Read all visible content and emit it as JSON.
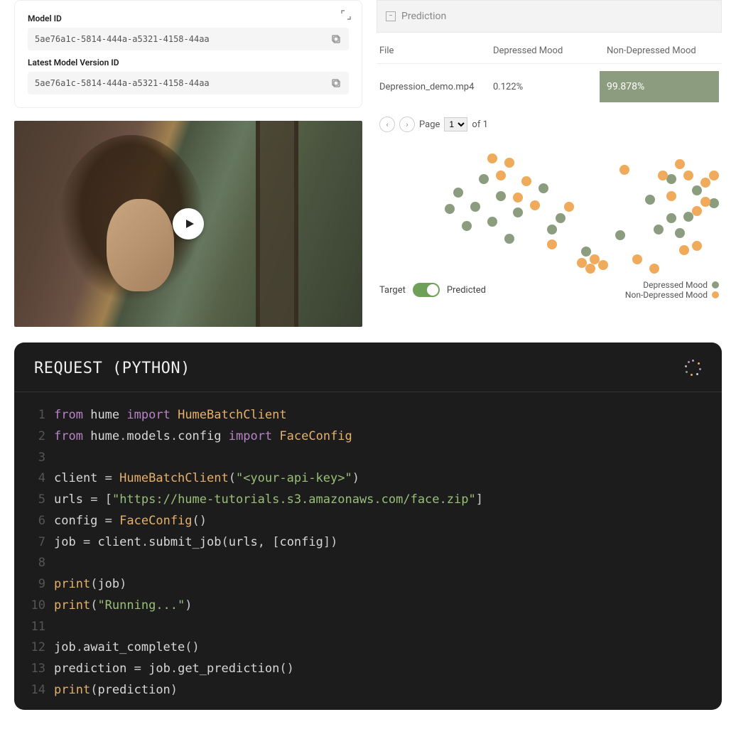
{
  "id_card": {
    "model_id_label": "Model ID",
    "model_id_value": "5ae76a1c-5814-444a-a5321-4158-44aa",
    "version_id_label": "Latest Model Version ID",
    "version_id_value": "5ae76a1c-5814-444a-a5321-4158-44aa"
  },
  "prediction": {
    "header": "Prediction",
    "columns": {
      "file": "File",
      "depressed": "Depressed Mood",
      "non_depressed": "Non-Depressed Mood"
    },
    "row": {
      "file": "Depression_demo.mp4",
      "depressed": "0.122%",
      "non_depressed": "99.878%"
    },
    "pager": {
      "page_label": "Page",
      "current": "1",
      "of_label": "of 1"
    }
  },
  "scatter_footer": {
    "target": "Target",
    "predicted": "Predicted",
    "legend_depressed": "Depressed Mood",
    "legend_non_depressed": "Non-Depressed Mood"
  },
  "code": {
    "title": "REQUEST (PYTHON)",
    "lines": [
      [
        [
          "kw",
          "from"
        ],
        [
          "sp",
          " "
        ],
        [
          "id",
          "hume"
        ],
        [
          "sp",
          " "
        ],
        [
          "kw",
          "import"
        ],
        [
          "sp",
          " "
        ],
        [
          "cls",
          "HumeBatchClient"
        ]
      ],
      [
        [
          "kw",
          "from"
        ],
        [
          "sp",
          " "
        ],
        [
          "id",
          "hume"
        ],
        [
          "dot",
          "."
        ],
        [
          "id",
          "models"
        ],
        [
          "dot",
          "."
        ],
        [
          "id",
          "config"
        ],
        [
          "sp",
          " "
        ],
        [
          "kw",
          "import"
        ],
        [
          "sp",
          " "
        ],
        [
          "cls",
          "FaceConfig"
        ]
      ],
      [],
      [
        [
          "id",
          "client"
        ],
        [
          "sp",
          " "
        ],
        [
          "pn",
          "="
        ],
        [
          "sp",
          " "
        ],
        [
          "cls",
          "HumeBatchClient"
        ],
        [
          "pn",
          "("
        ],
        [
          "str",
          "\"<your-api-key>\""
        ],
        [
          "pn",
          ")"
        ]
      ],
      [
        [
          "id",
          "urls"
        ],
        [
          "sp",
          " "
        ],
        [
          "pn",
          "="
        ],
        [
          "sp",
          " "
        ],
        [
          "pn",
          "["
        ],
        [
          "str",
          "\"https://hume-tutorials.s3.amazonaws.com/face.zip\""
        ],
        [
          "pn",
          "]"
        ]
      ],
      [
        [
          "id",
          "config"
        ],
        [
          "sp",
          " "
        ],
        [
          "pn",
          "="
        ],
        [
          "sp",
          " "
        ],
        [
          "cls",
          "FaceConfig"
        ],
        [
          "pn",
          "("
        ],
        [
          "pn",
          ")"
        ]
      ],
      [
        [
          "id",
          "job"
        ],
        [
          "sp",
          " "
        ],
        [
          "pn",
          "="
        ],
        [
          "sp",
          " "
        ],
        [
          "id",
          "client"
        ],
        [
          "dot",
          "."
        ],
        [
          "fn",
          "submit_job"
        ],
        [
          "pn",
          "("
        ],
        [
          "id",
          "urls"
        ],
        [
          "pn",
          ","
        ],
        [
          "sp",
          " "
        ],
        [
          "pn",
          "["
        ],
        [
          "id",
          "config"
        ],
        [
          "pn",
          "]"
        ],
        [
          "pn",
          ")"
        ]
      ],
      [],
      [
        [
          "cls",
          "print"
        ],
        [
          "pn",
          "("
        ],
        [
          "id",
          "job"
        ],
        [
          "pn",
          ")"
        ]
      ],
      [
        [
          "cls",
          "print"
        ],
        [
          "pn",
          "("
        ],
        [
          "str",
          "\"Running...\""
        ],
        [
          "pn",
          ")"
        ]
      ],
      [],
      [
        [
          "id",
          "job"
        ],
        [
          "dot",
          "."
        ],
        [
          "fn",
          "await_complete"
        ],
        [
          "pn",
          "("
        ],
        [
          "pn",
          ")"
        ]
      ],
      [
        [
          "id",
          "prediction"
        ],
        [
          "sp",
          " "
        ],
        [
          "pn",
          "="
        ],
        [
          "sp",
          " "
        ],
        [
          "id",
          "job"
        ],
        [
          "dot",
          "."
        ],
        [
          "fn",
          "get_prediction"
        ],
        [
          "pn",
          "("
        ],
        [
          "pn",
          ")"
        ]
      ],
      [
        [
          "cls",
          "print"
        ],
        [
          "pn",
          "("
        ],
        [
          "id",
          "prediction"
        ],
        [
          "pn",
          ")"
        ]
      ]
    ]
  },
  "chart_data": {
    "type": "scatter",
    "title": "",
    "legend": [
      "Depressed Mood",
      "Non-Depressed Mood"
    ],
    "series": [
      {
        "name": "Depressed Mood",
        "color": "#8b9d7e",
        "points": [
          [
            16,
            62
          ],
          [
            18,
            44
          ],
          [
            20,
            80
          ],
          [
            22,
            60
          ],
          [
            24,
            30
          ],
          [
            26,
            76
          ],
          [
            28,
            48
          ],
          [
            30,
            94
          ],
          [
            32,
            66
          ],
          [
            38,
            40
          ],
          [
            40,
            84
          ],
          [
            42,
            72
          ],
          [
            48,
            108
          ],
          [
            56,
            90
          ],
          [
            63,
            52
          ],
          [
            65,
            84
          ],
          [
            68,
            72
          ],
          [
            68,
            30
          ],
          [
            70,
            88
          ],
          [
            72,
            70
          ],
          [
            74,
            42
          ],
          [
            78,
            56
          ]
        ]
      },
      {
        "name": "Non-Depressed Mood",
        "color": "#f0aa5b",
        "points": [
          [
            26,
            8
          ],
          [
            28,
            26
          ],
          [
            30,
            12
          ],
          [
            32,
            50
          ],
          [
            34,
            32
          ],
          [
            36,
            58
          ],
          [
            40,
            100
          ],
          [
            44,
            60
          ],
          [
            47,
            120
          ],
          [
            49,
            126
          ],
          [
            50,
            116
          ],
          [
            52,
            122
          ],
          [
            57,
            20
          ],
          [
            60,
            116
          ],
          [
            64,
            126
          ],
          [
            66,
            26
          ],
          [
            68,
            48
          ],
          [
            70,
            14
          ],
          [
            71,
            106
          ],
          [
            72,
            26
          ],
          [
            74,
            64
          ],
          [
            74,
            102
          ],
          [
            76,
            34
          ],
          [
            76,
            54
          ],
          [
            78,
            26
          ]
        ]
      }
    ]
  }
}
